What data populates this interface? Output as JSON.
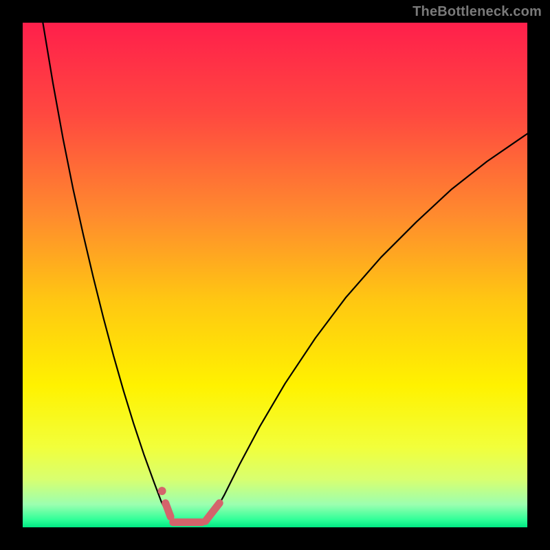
{
  "watermark": "TheBottleneck.com",
  "chart_data": {
    "type": "line",
    "title": "",
    "xlabel": "",
    "ylabel": "",
    "xlim": [
      0,
      100
    ],
    "ylim": [
      0,
      100
    ],
    "grid": false,
    "legend": false,
    "gradient_stops": [
      {
        "offset": 0.0,
        "color": "#ff1f4b"
      },
      {
        "offset": 0.18,
        "color": "#ff4840"
      },
      {
        "offset": 0.38,
        "color": "#ff8a2e"
      },
      {
        "offset": 0.55,
        "color": "#ffc712"
      },
      {
        "offset": 0.72,
        "color": "#fff200"
      },
      {
        "offset": 0.84,
        "color": "#f2ff3a"
      },
      {
        "offset": 0.905,
        "color": "#d8ff70"
      },
      {
        "offset": 0.955,
        "color": "#9bffb0"
      },
      {
        "offset": 0.985,
        "color": "#2fff98"
      },
      {
        "offset": 1.0,
        "color": "#00e884"
      }
    ],
    "series": [
      {
        "name": "left-branch",
        "stroke": "#000000",
        "stroke_width": 2.2,
        "x": [
          4.0,
          6.0,
          8.0,
          10.0,
          12.0,
          14.0,
          16.0,
          18.0,
          20.0,
          22.0,
          24.0,
          26.0,
          27.5,
          29.0
        ],
        "y": [
          100.0,
          88.0,
          77.0,
          67.0,
          58.0,
          49.5,
          41.5,
          34.0,
          27.0,
          20.5,
          14.5,
          9.0,
          5.0,
          2.0
        ]
      },
      {
        "name": "right-branch",
        "stroke": "#000000",
        "stroke_width": 2.2,
        "x": [
          37.5,
          40.0,
          43.0,
          47.0,
          52.0,
          58.0,
          64.0,
          71.0,
          78.0,
          85.0,
          92.0,
          100.0
        ],
        "y": [
          2.0,
          6.5,
          12.5,
          20.0,
          28.5,
          37.5,
          45.5,
          53.5,
          60.5,
          67.0,
          72.5,
          78.0
        ]
      },
      {
        "name": "valley-segments",
        "stroke": "#d4646b",
        "stroke_width": 11,
        "linecap": "round",
        "segments": [
          {
            "x1": 28.3,
            "y1": 4.8,
            "x2": 29.3,
            "y2": 2.1
          },
          {
            "x1": 29.8,
            "y1": 1.0,
            "x2": 35.5,
            "y2": 1.0
          },
          {
            "x1": 36.2,
            "y1": 1.2,
            "x2": 39.0,
            "y2": 4.8
          }
        ]
      },
      {
        "name": "valley-dot",
        "type": "scatter",
        "color": "#d4646b",
        "radius": 6,
        "x": [
          27.6
        ],
        "y": [
          7.2
        ]
      }
    ]
  }
}
